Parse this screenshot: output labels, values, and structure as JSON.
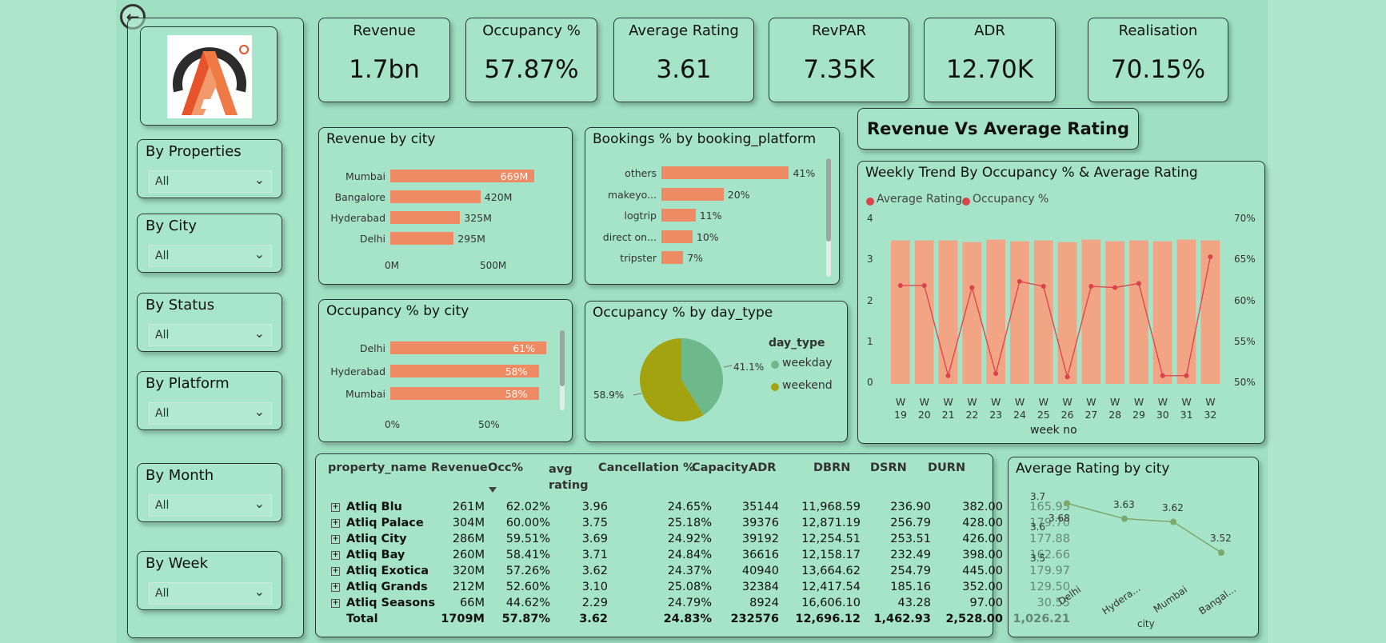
{
  "kpis": [
    {
      "label": "Revenue",
      "value": "1.7bn"
    },
    {
      "label": "Occupancy %",
      "value": "57.87%"
    },
    {
      "label": "Average Rating",
      "value": "3.61"
    },
    {
      "label": "RevPAR",
      "value": "7.35K"
    },
    {
      "label": "ADR",
      "value": "12.70K"
    },
    {
      "label": "Realisation",
      "value": "70.15%"
    }
  ],
  "filters": [
    {
      "title": "By Properties",
      "value": "All"
    },
    {
      "title": "By City",
      "value": "All"
    },
    {
      "title": "By Status",
      "value": "All"
    },
    {
      "title": "By Platform",
      "value": "All"
    },
    {
      "title": "By Month",
      "value": "All"
    },
    {
      "title": "By Week",
      "value": "All"
    }
  ],
  "revenue_vs_rating_title": "Revenue Vs Average Rating",
  "icons": {
    "back": "back-arrow-icon",
    "dropdown": "chevron-down-icon",
    "expand": "expand-plus-icon",
    "sort": "sort-desc-icon"
  },
  "colors": {
    "bar": "#ee8b64",
    "line": "#d9434b",
    "pie_weekday": "#6db989",
    "pie_weekend": "#a3a30f",
    "rating_line": "#7ea86a"
  },
  "chart_data": [
    {
      "type": "bar",
      "orientation": "horizontal",
      "title": "Revenue by city",
      "categories": [
        "Mumbai",
        "Bangalore",
        "Hyderabad",
        "Delhi"
      ],
      "values": [
        669,
        420,
        325,
        295
      ],
      "labels": [
        "669M",
        "420M",
        "325M",
        "295M"
      ],
      "xticks": [
        "0M",
        "500M"
      ],
      "xlim": [
        0,
        700
      ]
    },
    {
      "type": "bar",
      "orientation": "horizontal",
      "title": "Bookings % by booking_platform",
      "categories": [
        "others",
        "makeyo...",
        "logtrip",
        "direct on...",
        "tripster"
      ],
      "values": [
        41,
        20,
        11,
        10,
        7
      ],
      "labels": [
        "41%",
        "20%",
        "11%",
        "10%",
        "7%"
      ],
      "xlim": [
        0,
        45
      ]
    },
    {
      "type": "bar",
      "orientation": "horizontal",
      "title": "Occupancy % by city",
      "categories": [
        "Delhi",
        "Hyderabad",
        "Mumbai"
      ],
      "values": [
        61,
        58,
        58
      ],
      "labels": [
        "61%",
        "58%",
        "58%"
      ],
      "xticks": [
        "0%",
        "50%"
      ],
      "xlim": [
        0,
        70
      ]
    },
    {
      "type": "pie",
      "title": "Occupancy % by day_type",
      "legend_title": "day_type",
      "categories": [
        "weekday",
        "weekend"
      ],
      "values": [
        41.1,
        58.9
      ],
      "labels": [
        "41.1%",
        "58.9%"
      ]
    },
    {
      "type": "bar+line",
      "title": "Weekly Trend By Occupancy % & Average Rating",
      "legend": [
        "Average Rating",
        "Occupancy %"
      ],
      "xlabel": "week no",
      "x": [
        "W 19",
        "W 20",
        "W 21",
        "W 22",
        "W 23",
        "W 24",
        "W 25",
        "W 26",
        "W 27",
        "W 28",
        "W 29",
        "W 30",
        "W 31",
        "W 32"
      ],
      "bars_occupancy_pct": [
        67.5,
        67.5,
        67.5,
        67.3,
        67.6,
        67.4,
        67.5,
        67.3,
        67.6,
        67.4,
        67.5,
        67.4,
        67.6,
        67.5
      ],
      "line_avg_rating": [
        2.4,
        2.4,
        0.2,
        2.35,
        0.25,
        2.5,
        2.38,
        0.17,
        2.38,
        2.35,
        2.45,
        0.2,
        0.2,
        3.1
      ],
      "yleft_ticks": [
        "4",
        "3",
        "2",
        "1",
        "0"
      ],
      "yright_ticks": [
        "70%",
        "65%",
        "60%",
        "55%",
        "50%"
      ],
      "yleft_lim": [
        0,
        4
      ],
      "yright_lim": [
        50,
        70
      ]
    },
    {
      "type": "line",
      "title": "Average Rating by city",
      "categories": [
        "Delhi",
        "Hydera...",
        "Mumbai",
        "Bangal..."
      ],
      "values": [
        3.68,
        3.63,
        3.62,
        3.52
      ],
      "labels": [
        "3.68",
        "3.63",
        "3.62",
        "3.52"
      ],
      "yticks": [
        "3.7",
        "3.6",
        "3.5"
      ],
      "ylim": [
        3.45,
        3.72
      ],
      "xlabel": "city"
    }
  ],
  "table": {
    "headers": [
      "property_name",
      "Revenue",
      "Occ%",
      "avg rating",
      "Cancellation %",
      "Capacity",
      "ADR",
      "DBRN",
      "DSRN",
      "DURN"
    ],
    "rows": [
      [
        "Atliq Blu",
        "261M",
        "62.02%",
        "3.96",
        "24.65%",
        "35144",
        "11,968.59",
        "236.90",
        "382.00",
        "165.95"
      ],
      [
        "Atliq Palace",
        "304M",
        "60.00%",
        "3.75",
        "25.18%",
        "39376",
        "12,871.19",
        "256.79",
        "428.00",
        "179.70"
      ],
      [
        "Atliq City",
        "286M",
        "59.51%",
        "3.69",
        "24.92%",
        "39192",
        "12,254.51",
        "253.51",
        "426.00",
        "177.88"
      ],
      [
        "Atliq Bay",
        "260M",
        "58.41%",
        "3.71",
        "24.84%",
        "36616",
        "12,158.17",
        "232.49",
        "398.00",
        "162.66"
      ],
      [
        "Atliq Exotica",
        "320M",
        "57.26%",
        "3.62",
        "24.37%",
        "40940",
        "13,664.62",
        "254.79",
        "445.00",
        "179.97"
      ],
      [
        "Atliq Grands",
        "212M",
        "52.60%",
        "3.10",
        "25.08%",
        "32384",
        "12,417.54",
        "185.16",
        "352.00",
        "129.50"
      ],
      [
        "Atliq Seasons",
        "66M",
        "44.62%",
        "2.29",
        "24.79%",
        "8924",
        "16,606.10",
        "43.28",
        "97.00",
        "30.55"
      ]
    ],
    "total": [
      "Total",
      "1709M",
      "57.87%",
      "3.62",
      "24.83%",
      "232576",
      "12,696.12",
      "1,462.93",
      "2,528.00",
      "1,026.21"
    ]
  }
}
